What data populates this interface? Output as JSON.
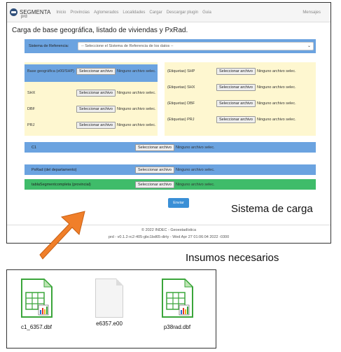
{
  "navbar": {
    "brand": "SEGMENTA",
    "brand_sub": "prd",
    "links": [
      "Inicio",
      "Provincias",
      "Aglomerados",
      "Localidades",
      "Cargar",
      "Descargar plugin",
      "Guia"
    ],
    "right": "Mensajes"
  },
  "page_title": "Carga de base geográfica, listado de viviendas y PxRad.",
  "reference": {
    "label": "Sistema de Referencia:",
    "selected": "-- Seleccione el Sistema de Referencia de los datos --"
  },
  "file_button": "Seleccionar archivo",
  "no_file": "Ninguno archivo selec.",
  "left_files": [
    "Base geográfica (e00/SHP)",
    "SHX",
    "DBF",
    "PRJ"
  ],
  "right_files": [
    "(Etiquetas) SHP",
    "(Etiquetas) SHX",
    "(Etiquetas) DBF",
    "(Etiquetas) PRJ"
  ],
  "bars": {
    "c1": "C1",
    "pxrad": "PxRad (del departamento)",
    "tabla": "tablaSegmentcompleta (provincial)"
  },
  "submit": "Enviar",
  "footer": {
    "line1": "© 2022 INDEC - Geoestadística",
    "line2": "prd - v0.1.2-rc2-405-gbc1bd65-dirty - Wed Apr 27 01:06:04 2022 -0300"
  },
  "captions": {
    "system": "Sistema de carga",
    "inputs": "Insumos necesarios"
  },
  "files": [
    {
      "name": "c1_6357.dbf",
      "icon": "spreadsheet-icon"
    },
    {
      "name": "e6357.e00",
      "icon": "generic-file-icon"
    },
    {
      "name": "p38rad.dbf",
      "icon": "spreadsheet-icon"
    }
  ],
  "colors": {
    "blue_bar": "#6ba3e0",
    "yellow_panel": "#fef7d0",
    "green_bar": "#3fbc6a",
    "submit": "#3a8fd6",
    "arrow": "#f07f2a"
  }
}
